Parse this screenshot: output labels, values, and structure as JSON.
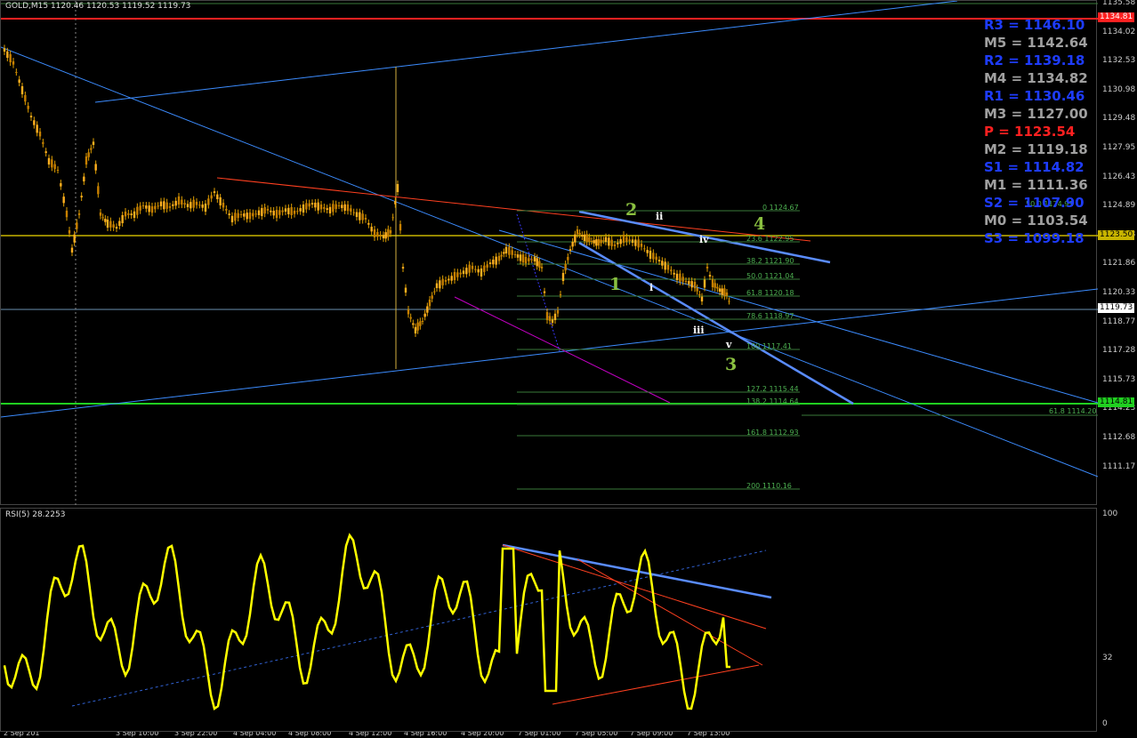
{
  "header": {
    "title": "GOLD,M15  1120.46 1120.53 1119.52 1119.73"
  },
  "rsi": {
    "title": "RSI(5) 28.2253",
    "levels": [
      "100",
      "32",
      "0"
    ]
  },
  "price_axis": {
    "ticks": [
      "1135.58",
      "1134.02",
      "1132.53",
      "1130.98",
      "1129.48",
      "1127.95",
      "1126.43",
      "1124.89",
      "1123.38",
      "1121.86",
      "1120.33",
      "1118.77",
      "1117.28",
      "1115.73",
      "1114.23",
      "1112.68",
      "1111.17"
    ],
    "tags": {
      "red_line": "1134.81",
      "yellow_line": "1123.50",
      "current": "1119.73",
      "green_line": "1114.81"
    }
  },
  "pivots": [
    {
      "label": "R3 = 1146.10",
      "color": "#1e3cff"
    },
    {
      "label": "M5 = 1142.64",
      "color": "#a0a0a0"
    },
    {
      "label": "R2 = 1139.18",
      "color": "#1e3cff"
    },
    {
      "label": "M4 = 1134.82",
      "color": "#a0a0a0"
    },
    {
      "label": "R1 = 1130.46",
      "color": "#1e3cff"
    },
    {
      "label": "M3 = 1127.00",
      "color": "#a0a0a0"
    },
    {
      "label": "P  = 1123.54",
      "color": "#ff2020"
    },
    {
      "label": "M2 = 1119.18",
      "color": "#a0a0a0"
    },
    {
      "label": "S1 = 1114.82",
      "color": "#1e3cff"
    },
    {
      "label": "M1 = 1111.36",
      "color": "#a0a0a0"
    },
    {
      "label": "S2 = 1107.90",
      "color": "#1e3cff"
    },
    {
      "label": "M0 = 1103.54",
      "color": "#a0a0a0"
    },
    {
      "label": "S3 = 1099.18",
      "color": "#1e3cff"
    }
  ],
  "fib_levels": [
    {
      "label": "0 1124.67"
    },
    {
      "label": "23.6 1122.95"
    },
    {
      "label": "38.2 1121.90"
    },
    {
      "label": "50.0 1121.04"
    },
    {
      "label": "61.8 1120.18"
    },
    {
      "label": "78.6 1118.97"
    },
    {
      "label": "100 1117.41"
    },
    {
      "label": "127.2 1115.44"
    },
    {
      "label": "138.2 1114.64"
    },
    {
      "label": "161.8 1112.93"
    },
    {
      "label": "200 1110.16"
    }
  ],
  "fib_extra": {
    "top_right": "50.0 1124.91",
    "bottom_right": "61.8 1114.20"
  },
  "waves": {
    "green": [
      "1",
      "2",
      "3",
      "4"
    ],
    "white": [
      "i",
      "ii",
      "iii",
      "iv",
      "v"
    ]
  },
  "time_axis": [
    "2 Sep 201",
    "3 Sep 10:00",
    "3 Sep 22:00",
    "4 Sep 04:00",
    "4 Sep 08:00",
    "4 Sep 12:00",
    "4 Sep 16:00",
    "4 Sep 20:00",
    "7 Sep 01:00",
    "7 Sep 05:00",
    "7 Sep 09:00",
    "7 Sep 13:00"
  ],
  "colors": {
    "candle": "#e0a000",
    "rsi_line": "#ffff00",
    "trend_blue": "#3c8cff",
    "trend_red": "#ff4020",
    "fib": "#3a7a3a",
    "magenta": "#c000c0"
  }
}
